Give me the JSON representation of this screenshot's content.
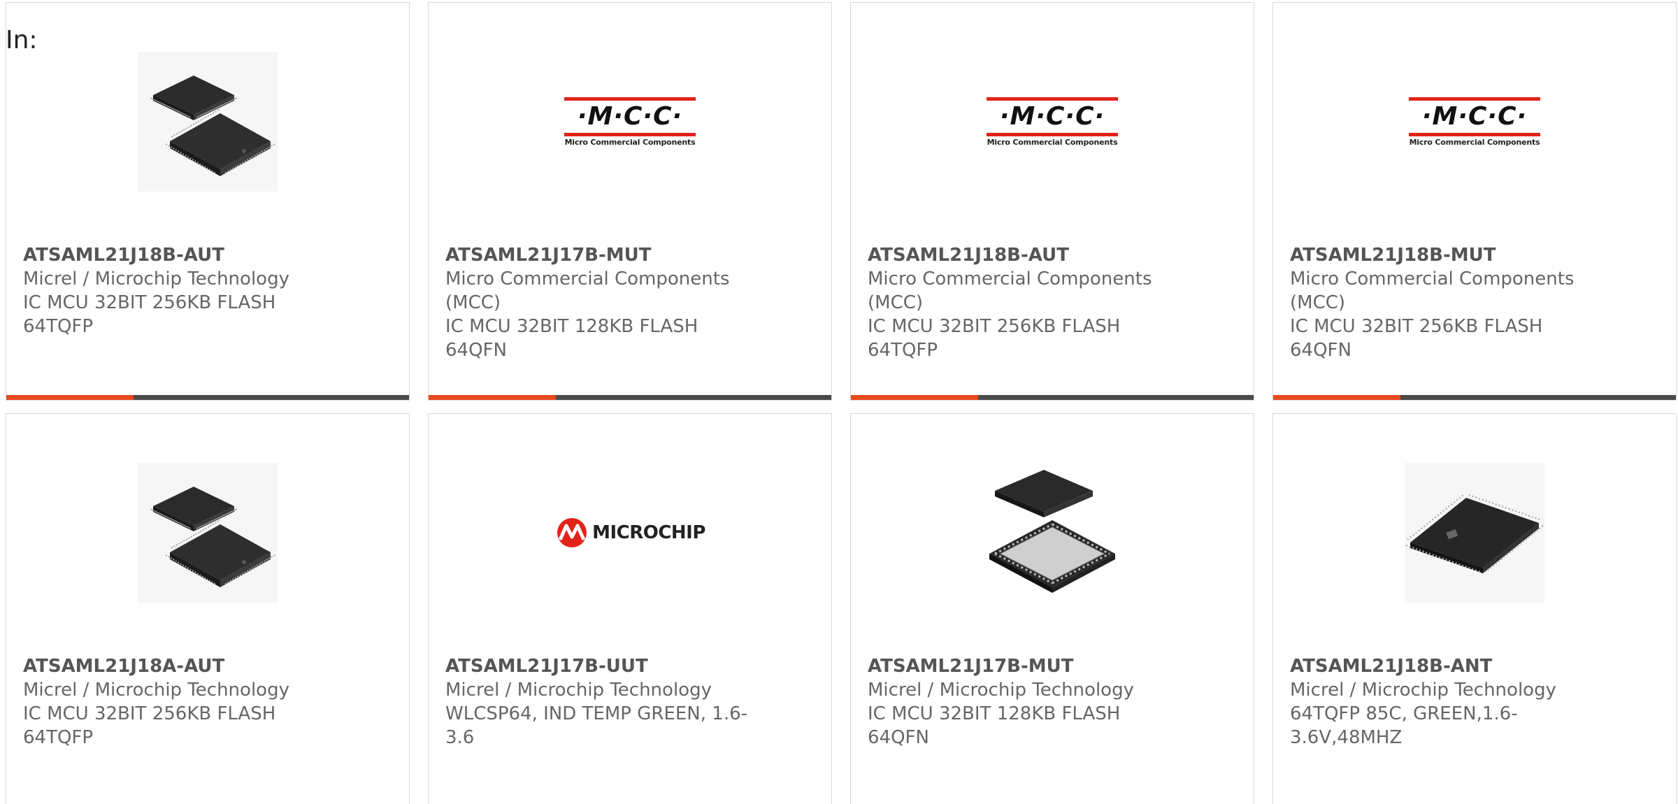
{
  "header": {
    "in_label": "In:"
  },
  "products": [
    {
      "part": "ATSAML21J18B-AUT",
      "manufacturer": "Micrel / Microchip Technology",
      "description": "IC MCU 32BIT 256KB FLASH\n64TQFP",
      "image_icon": "tqfp-chip-pair-icon"
    },
    {
      "part": "ATSAML21J17B-MUT",
      "manufacturer": "Micro Commercial Components\n(MCC)",
      "description": "IC MCU 32BIT 128KB FLASH\n64QFN",
      "image_icon": "mcc-logo-icon"
    },
    {
      "part": "ATSAML21J18B-AUT",
      "manufacturer": "Micro Commercial Components\n(MCC)",
      "description": "IC MCU 32BIT 256KB FLASH\n64TQFP",
      "image_icon": "mcc-logo-icon"
    },
    {
      "part": "ATSAML21J18B-MUT",
      "manufacturer": "Micro Commercial Components\n(MCC)",
      "description": "IC MCU 32BIT 256KB FLASH\n64QFN",
      "image_icon": "mcc-logo-icon"
    },
    {
      "part": "ATSAML21J18A-AUT",
      "manufacturer": "Micrel / Microchip Technology",
      "description": "IC MCU 32BIT 256KB FLASH\n64TQFP",
      "image_icon": "tqfp-chip-pair-icon"
    },
    {
      "part": "ATSAML21J17B-UUT",
      "manufacturer": "Micrel / Microchip Technology",
      "description": "WLCSP64, IND TEMP GREEN, 1.6-\n3.6",
      "image_icon": "microchip-logo-icon"
    },
    {
      "part": "ATSAML21J17B-MUT",
      "manufacturer": "Micrel / Microchip Technology",
      "description": "IC MCU 32BIT 128KB FLASH\n64QFN",
      "image_icon": "qfn-chip-pair-icon"
    },
    {
      "part": "ATSAML21J18B-ANT",
      "manufacturer": "Micrel / Microchip Technology",
      "description": "64TQFP 85C, GREEN,1.6-\n3.6V,48MHZ",
      "image_icon": "tqfp-chip-icon"
    }
  ],
  "logos": {
    "mcc_letters": "·M·C·C·",
    "mcc_subtitle": "Micro Commercial Components",
    "microchip_word": "MICROCHIP"
  },
  "colors": {
    "accent_orange": "#e84a1c",
    "accent_dark": "#4a4a4a",
    "mcc_red": "#e2231a",
    "microchip_red": "#e2231a"
  }
}
